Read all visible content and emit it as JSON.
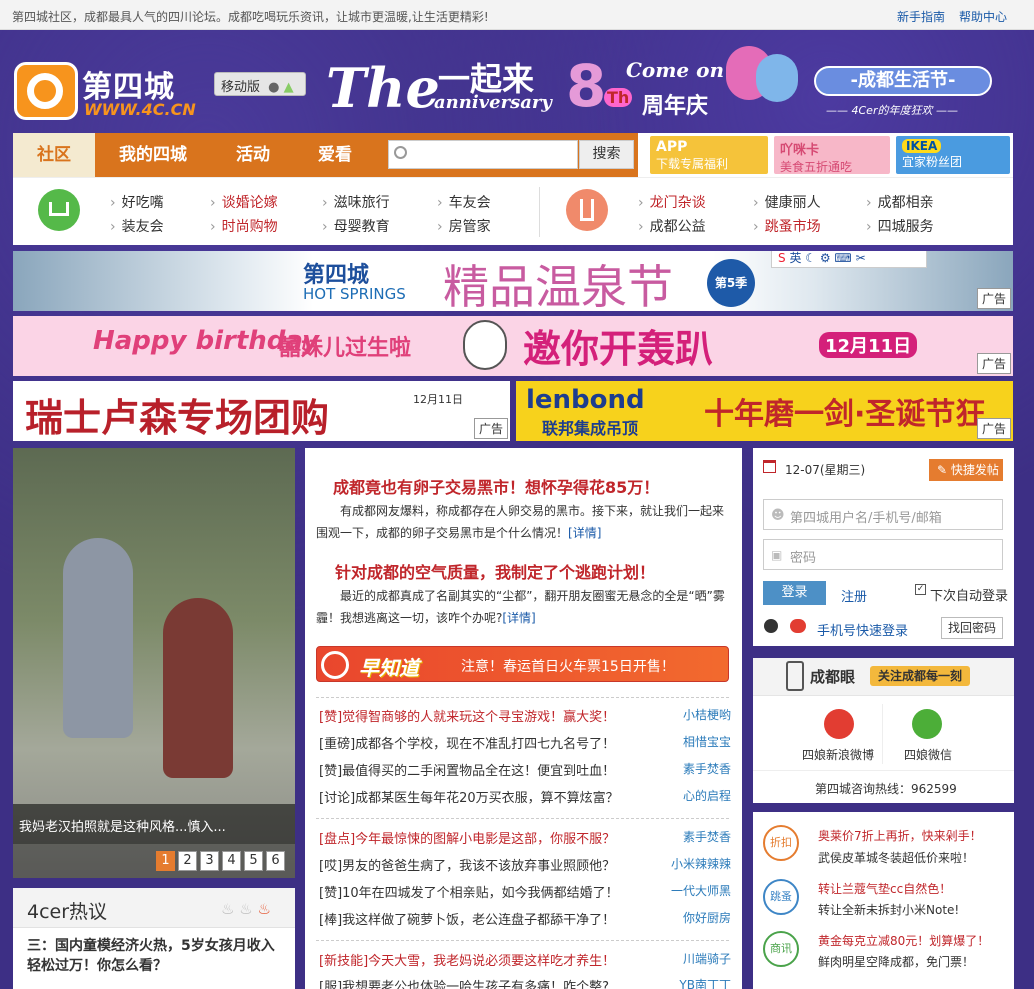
{
  "topbar": {
    "slogan": "第四城社区，成都最具人气的四川论坛。成都吃喝玩乐资讯，让城市更温暖,让生活更精彩!",
    "guide": "新手指南",
    "help": "帮助中心"
  },
  "header": {
    "logo_cn": "第四城",
    "logo_url": "WWW.4C.CN",
    "mobile": "移动版",
    "anniv_the": "The",
    "anniv_together": "一起来",
    "anniv_8": "8",
    "anniv_th": "Th",
    "anniv_word": "anniversary",
    "anniv_come": "Come on",
    "anniv_zhou": "周年庆",
    "festival": "-成都生活节-",
    "festival_sub": "—— 4Cer的年度狂欢 ——"
  },
  "nav": {
    "tabs": [
      "社区",
      "我的四城",
      "活动",
      "爱看"
    ],
    "search_btn": "搜索",
    "search_placeholder": ""
  },
  "promos": [
    {
      "title": "APP",
      "sub": "下载专属福利"
    },
    {
      "title": "吖咪卡",
      "sub": "美食五折通吃"
    },
    {
      "title": "IKEA",
      "sub": "宜家粉丝团"
    }
  ],
  "links": {
    "left": [
      [
        "好吃嘴",
        "谈婚论嫁",
        "滋味旅行",
        "车友会"
      ],
      [
        "装友会",
        "时尚购物",
        "母婴教育",
        "房管家"
      ]
    ],
    "right": [
      [
        "龙门杂谈",
        "健康丽人",
        "成都相亲"
      ],
      [
        "成都公益",
        "跳蚤市场",
        "四城服务"
      ]
    ]
  },
  "banners": {
    "spring_brand": "第四城",
    "spring_en": "HOT SPRINGS",
    "spring_title": "精品温泉节",
    "spring_season": "第5季",
    "ime": "英",
    "bday_en": "Happy birthday",
    "bday_cn": "囍妹儿过生啦",
    "bday_invite": "邀你开轰趴",
    "bday_date": "12月11日",
    "lucerne": "瑞士卢森专场团购",
    "lucerne_date": "12月11日",
    "lenbond": "lenbond",
    "lenbond_cn": "联邦集成吊顶",
    "lenbond_promo": "十年磨一剑·圣诞节狂欢",
    "ad": "广告"
  },
  "photo": {
    "caption": "我妈老汉拍照就是这种风格...慎入...",
    "pages": [
      "1",
      "2",
      "3",
      "4",
      "5",
      "6"
    ]
  },
  "hot": {
    "title": "4cer热议",
    "item": "三：国内童模经济火热，5岁女孩月收入轻松过万！你怎么看？"
  },
  "news": {
    "h1": "成都竟也有卵子交易黑市！想怀孕得花85万！",
    "s1": "有成都网友爆料，称成都存在人卵交易的黑市。接下来，就让我们一起来围观一下，成都的卵子交易黑市是个什么情况！",
    "h2": "针对成都的空气质量，我制定了个逃跑计划！",
    "s2": "最近的成都真成了名副其实的“尘都”，翻开朋友圈蜜无悬念的全是“晒”雾霾！我想逃离这一切，该咋个办呢?",
    "detail": "[详情]",
    "zaozhidao": "早知道",
    "notice": "注意！春运首日火车票15日开售！"
  },
  "list": [
    {
      "t": "[赞]觉得智商够的人就来玩这个寻宝游戏！赢大奖！",
      "a": "小桔梗哟",
      "red": true
    },
    {
      "t": "[重磅]成都各个学校，现在不准乱打四七九名号了！",
      "a": "相惜宝宝",
      "red": false
    },
    {
      "t": "[赞]最值得买的二手闲置物品全在这！便宜到吐血！",
      "a": "素手焚香",
      "red": false
    },
    {
      "t": "[讨论]成都某医生每年花20万买衣服，算不算炫富？",
      "a": "心的启程",
      "red": false
    },
    {
      "t": "[盘点]今年最惊悚的图解小电影是这部，你服不服？",
      "a": "素手焚香",
      "red": true
    },
    {
      "t": "[哎]男友的爸爸生病了，我该不该放弃事业照顾他？",
      "a": "小米辣辣辣",
      "red": false
    },
    {
      "t": "[赞]10年在四城发了个相亲贴，如今我俩都结婚了！",
      "a": "一代大师黑",
      "red": false
    },
    {
      "t": "[棒]我这样做了碗萝卜饭，老公连盘子都舔干净了！",
      "a": "你好厨房",
      "red": false
    },
    {
      "t": "[新技能]今天大雪，我老妈说必须要这样吃才养生！",
      "a": "川端骑子",
      "red": true
    },
    {
      "t": "[服]我想要老公也体验一哈生孩子有多痛！咋个整?",
      "a": "YB南丁丁",
      "red": false
    }
  ],
  "login": {
    "date": "12-07(星期三)",
    "post": "快捷发帖",
    "user_ph": "第四城用户名/手机号/邮箱",
    "pass_ph": "密码",
    "login": "登录",
    "register": "注册",
    "auto": "下次自动登录",
    "phone": "手机号快速登录",
    "forgot": "找回密码"
  },
  "eye": {
    "title": "成都眼",
    "slogan": "关注成都每一刻",
    "weibo": "四娘新浪微博",
    "weixin": "四娘微信",
    "hotline": "第四城咨询热线：962599"
  },
  "cats": [
    {
      "label": "折扣",
      "l1": "奥莱价7折上再折，快来剁手！",
      "l2": "武侯皮革城冬装超低价来啦！"
    },
    {
      "label": "跳蚤",
      "l1": "转让兰蔻气垫cc自然色！",
      "l2": "转让全新未拆封小米Note!"
    },
    {
      "label": "商讯",
      "l1": "黄金每克立减80元！划算爆了！",
      "l2": "鲜肉明星空降成都，免门票！"
    }
  ]
}
